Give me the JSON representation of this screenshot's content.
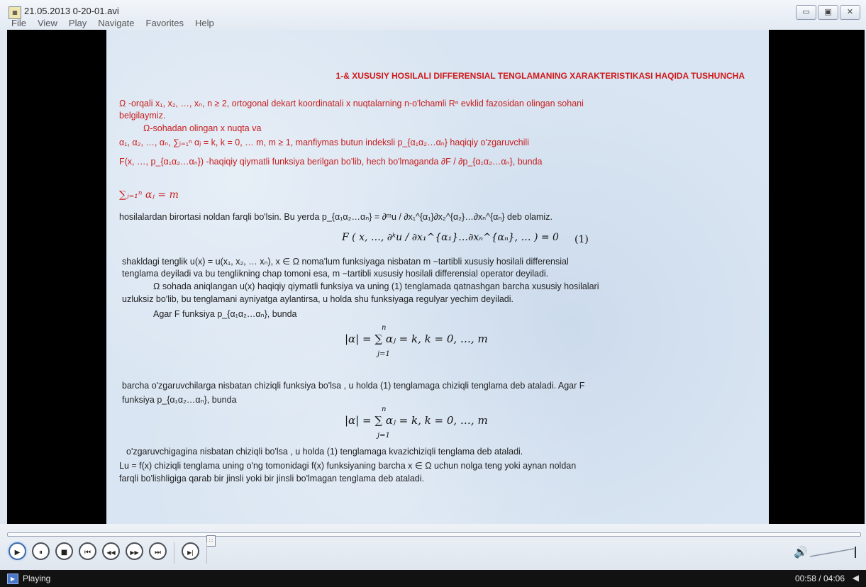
{
  "window": {
    "title": "21.05.2013 0-20-01.avi",
    "icon": "video-file-icon",
    "buttons": {
      "minimize": "▭",
      "maximize": "▣",
      "close": "✕"
    }
  },
  "menu": [
    "File",
    "View",
    "Play",
    "Navigate",
    "Favorites",
    "Help"
  ],
  "slide": {
    "title": "1-& XUSUSIY HOSILALI DIFFERENSIAL TENGLAMANING XARAKTERISTIKASI HAQIDA TUSHUNCHA",
    "l1": "Ω -orqali x₁, x₂, …, xₙ,  n ≥ 2, ortogonal dekart koordinatali x nuqtalarning n-o'lchamli Rⁿ  evklid fazosidan olingan sohani",
    "l2": "belgilaymiz.",
    "l3": "Ω-sohadan olingan x nuqta va",
    "l4": "α₁, α₂, …, αₙ,  ∑ⱼ₌₁ⁿ αⱼ = k,  k = 0, … m,  m ≥ 1,   manfiymas butun indeksli   p_{α₁α₂…αₙ}   haqiqiy o'zgaruvchili",
    "l5": "F(x, …, p_{α₁α₂…αₙ})   -haqiqiy qiymatli funksiya berilgan bo'lib, hech bo'lmaganda   ∂F / ∂p_{α₁α₂…αₙ},   bunda",
    "l6": "∑ⱼ₌₁ⁿ αⱼ = m",
    "l7": "hosilalardan birortasi noldan farqli bo'lsin. Bu yerda  p_{α₁α₂…αₙ} = ∂ᵐu / ∂x₁^{α₁}∂x₂^{α₂}…∂xₙ^{αₙ}    deb olamiz.",
    "eq1": "F ( x, …, ∂ᵏu / ∂x₁^{α₁}…∂xₙ^{αₙ}, … ) = 0",
    "eq1_num": "(1)",
    "l8": "shakldagi tenglik    u(x) = u(x₁, x₂, … xₙ),       x ∈ Ω    noma'lum funksiyaga nisbatan    m −tartibli xususiy hosilali  differensial",
    "l9": "tenglama  deyiladi  va  bu tenglikning  chap tomoni esa, m −tartibli xususiy hosilali  differensial operator  deyiladi.",
    "l10": "Ω   sohada aniqlangan u(x) haqiqiy qiymatli funksiya va uning  (1) tenglamada qatnashgan barcha xususiy hosilalari",
    "l11": "uzluksiz bo'lib,  bu tenglamani  ayniyatga aylantirsa, u holda shu funksiyaga regulyar yechim deyiladi.",
    "l12": "Agar F funksiya  p_{α₁α₂…αₙ},  bunda",
    "eq2": "|α| = ∑ αⱼ = k,          k = 0, …, m",
    "eq_sum_top": "n",
    "eq_sum_bot": "j=1",
    "l13": "barcha  o'zgaruvchilarga  nisbatan  chiziqli  funksiya  bo'lsa , u holda  (1)  tenglamaga  chiziqli tenglama  deb ataladi.     Agar F",
    "l14": "funksiya  p_{α₁α₂…αₙ},  bunda",
    "eq3": "|α| = ∑ αⱼ = k,          k = 0, …, m",
    "l15": "o'zgaruvchigagina  nisbatan  chiziqli  bo'lsa , u holda  (1)  tenglamaga  kvazichiziqli tenglama deb ataladi.",
    "l16": "Lu = f(x)   chiziqli tenglama  uning  o'ng tomonidagi    f(x) funksiyaning barcha   x ∈ Ω   uchun nolga teng yoki aynan  noldan",
    "l17": "farqli bo'lishligiga  qarab  bir jinsli yoki bir jinsli bo'lmagan tenglama deb ataladi."
  },
  "player": {
    "seek_fraction": 0.238,
    "buttons": [
      {
        "name": "play-button",
        "glyph": "▶"
      },
      {
        "name": "pause-button",
        "glyph": "⏸"
      },
      {
        "name": "stop-button",
        "glyph": "■"
      },
      {
        "name": "previous-button",
        "glyph": "⏮"
      },
      {
        "name": "rewind-button",
        "glyph": "◀◀"
      },
      {
        "name": "fast-forward-button",
        "glyph": "▶▶"
      },
      {
        "name": "next-button",
        "glyph": "⏭"
      },
      {
        "name": "frame-step-button",
        "glyph": "▶|"
      }
    ]
  },
  "status": {
    "state": "Playing",
    "time": "00:58 / 04:06"
  },
  "colors": {
    "accent": "#3d6aa8",
    "title_red": "#d01818",
    "status_bg": "#121212"
  }
}
